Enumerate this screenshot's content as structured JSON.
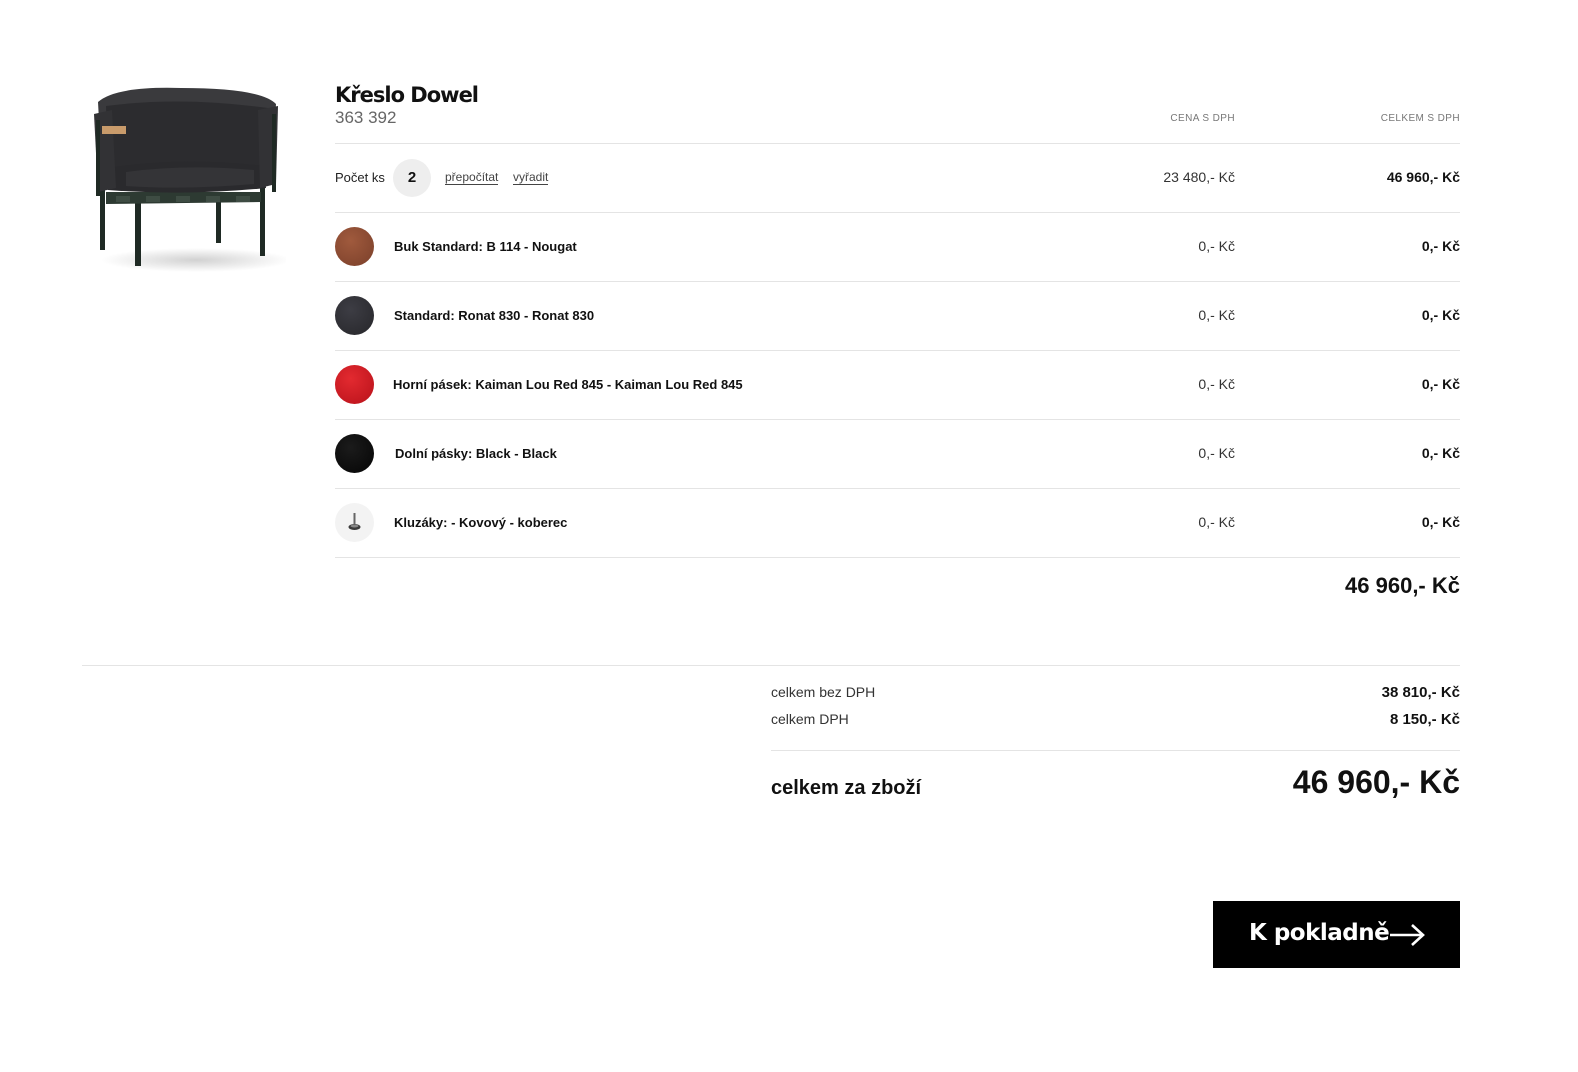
{
  "product": {
    "name": "Křeslo Dowel",
    "code": "363 392",
    "image_icon": "armchair-image"
  },
  "columns": {
    "unit_price": "CENA S DPH",
    "total_price": "CELKEM S DPH"
  },
  "quantity_row": {
    "label": "Počet ks",
    "value": "2",
    "recalc_link": "přepočítat",
    "remove_link": "vyřadit",
    "unit_price": "23 480,- Kč",
    "total_price": "46 960,- Kč"
  },
  "options": [
    {
      "label": "Buk Standard: B 114 - Nougat",
      "unit_price": "0,- Kč",
      "total_price": "0,- Kč",
      "swatch_color": "#8a4a32"
    },
    {
      "label": "Standard: Ronat 830 - Ronat 830",
      "unit_price": "0,- Kč",
      "total_price": "0,- Kč",
      "swatch_color": "#2f2f34"
    },
    {
      "label": "Horní pásek: Kaiman Lou Red 845 - Kaiman Lou Red 845",
      "unit_price": "0,- Kč",
      "total_price": "0,- Kč",
      "swatch_color": "#d0161e"
    },
    {
      "label": "Dolní pásky: Black - Black",
      "unit_price": "0,- Kč",
      "total_price": "0,- Kč",
      "swatch_color": "#0c0c0c"
    },
    {
      "label": "Kluzáky: - Kovový - koberec",
      "unit_price": "0,- Kč",
      "total_price": "0,- Kč",
      "swatch_color": "#f2f2f2"
    }
  ],
  "item_total": "46 960,- Kč",
  "summary": {
    "without_vat_label": "celkem bez DPH",
    "without_vat_value": "38 810,- Kč",
    "vat_label": "celkem DPH",
    "vat_value": "8 150,- Kč",
    "grand_label": "celkem za zboží",
    "grand_value": "46 960,- Kč"
  },
  "checkout": {
    "label": "K pokladně",
    "icon": "arrow-right-icon"
  }
}
